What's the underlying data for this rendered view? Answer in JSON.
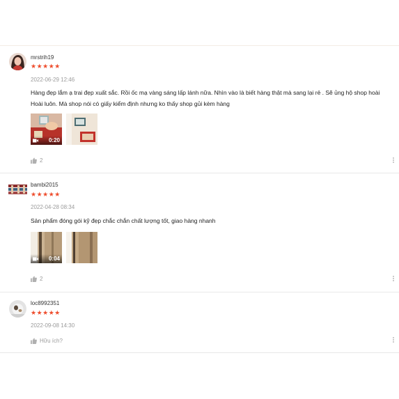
{
  "reviews": [
    {
      "username": "mrstrih19",
      "stars": "★★★★★",
      "timestamp": "2022-06-29 12:46",
      "comment": "Hàng đẹp lắm ạ trai đẹp xuất sắc. Rồi ốc mạ vàng sáng lấp lánh nữa. Nhìn vào là biết hàng thật mà sang lại rẻ . Sẽ ủng hộ shop hoài Hoài luôn. Mà shop nói có giấy kiểm định nhưng ko thấy shop gủi kèm hàng",
      "video_duration": "0:20",
      "likes": "2"
    },
    {
      "username": "bambi2015",
      "stars": "★★★★★",
      "timestamp": "2022-04-28 08:34",
      "comment": "Sản phẩm đóng gói kỹ đẹp chắc chắn chất lượng tốt, giao hàng nhanh",
      "video_duration": "0:04",
      "likes": "2"
    },
    {
      "username": "loc8992351",
      "stars": "★★★★★",
      "timestamp": "2022-09-08 14:30",
      "likes": "Hữu ích?"
    }
  ],
  "colors": {
    "star": "#ee4d2d",
    "muted": "#9b9b9b",
    "divider": "#e8e8e8"
  }
}
